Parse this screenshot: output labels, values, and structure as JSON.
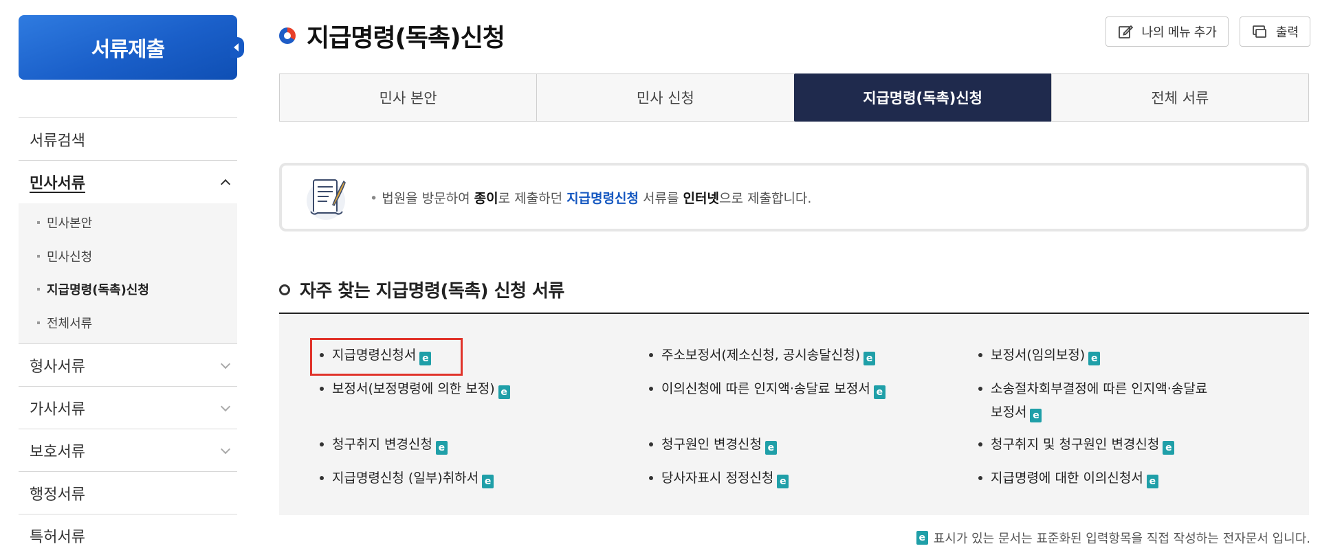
{
  "sidebar": {
    "header": "서류제출",
    "items": [
      {
        "label": "서류검색",
        "chevron": "none"
      },
      {
        "label": "민사서류",
        "chevron": "up",
        "sub": [
          "민사본안",
          "민사신청",
          "지급명령(독촉)신청",
          "전체서류"
        ],
        "current": "지급명령(독촉)신청"
      },
      {
        "label": "형사서류",
        "chevron": "down"
      },
      {
        "label": "가사서류",
        "chevron": "down"
      },
      {
        "label": "보호서류",
        "chevron": "down"
      },
      {
        "label": "행정서류",
        "chevron": "none"
      },
      {
        "label": "특허서류",
        "chevron": "none"
      }
    ]
  },
  "header": {
    "title": "지급명령(독촉)신청",
    "add_menu_label": "나의 메뉴 추가",
    "print_label": "출력"
  },
  "tabs": [
    {
      "label": "민사 본안",
      "active": false
    },
    {
      "label": "민사 신청",
      "active": false
    },
    {
      "label": "지급명령(독촉)신청",
      "active": true
    },
    {
      "label": "전체 서류",
      "active": false
    }
  ],
  "notice": {
    "p1": "법원을 방문하여 ",
    "b1": "종이",
    "p2": "로 제출하던 ",
    "hl": "지급명령신청",
    "p3": " 서류를 ",
    "b2": "인터넷",
    "p4": "으로 제출합니다."
  },
  "section": {
    "title": "자주 찾는 지급명령(독촉) 신청 서류"
  },
  "documents": [
    {
      "label": "지급명령신청서",
      "electronic": true,
      "selected": true
    },
    {
      "label": "주소보정서(제소신청, 공시송달신청)",
      "electronic": true
    },
    {
      "label": "보정서(임의보정)",
      "electronic": true
    },
    {
      "label": "보정서(보정명령에 의한 보정)",
      "electronic": true
    },
    {
      "label": "이의신청에 따른 인지액·송달료 보정서",
      "electronic": true
    },
    {
      "label": "소송절차회부결정에 따른 인지액·송달료",
      "label2": "보정서",
      "electronic": true
    },
    {
      "label": "청구취지 변경신청",
      "electronic": true
    },
    {
      "label": "청구원인 변경신청",
      "electronic": true
    },
    {
      "label": "청구취지 및 청구원인 변경신청",
      "electronic": true
    },
    {
      "label": "지급명령신청 (일부)취하서",
      "electronic": true
    },
    {
      "label": "당사자표시 정정신청",
      "electronic": true
    },
    {
      "label": "지급명령에 대한 이의신청서",
      "electronic": true
    }
  ],
  "e_icon_char": "e",
  "footnote": "표시가 있는 문서는 표준화된 입력항목을 직접 작성하는 전자문서 입니다.",
  "colors": {
    "accent_blue": "#1a5fc9",
    "tab_active": "#1f2a4d",
    "e_icon": "#1f9fa8",
    "selection": "#e0332a"
  }
}
